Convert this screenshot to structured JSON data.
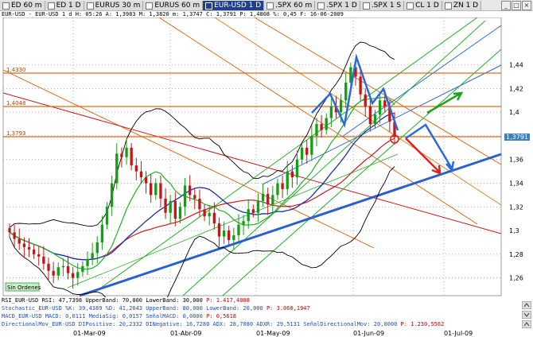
{
  "tabs": [
    {
      "label": "ED 60 m",
      "active": false
    },
    {
      "label": "ED 1 D",
      "active": false
    },
    {
      "label": "EURUS 30 m",
      "active": false
    },
    {
      "label": "EURUS 60 m",
      "active": false
    },
    {
      "label": "EUR-USD 1 D",
      "active": true
    },
    {
      "label": ".SPX 60 m",
      "active": false
    },
    {
      "label": ".SPX 1 D",
      "active": false
    },
    {
      "label": ".SPX 1 S",
      "active": false
    },
    {
      "label": "CL 1 D",
      "active": false
    },
    {
      "label": "ZN 1 D",
      "active": false
    }
  ],
  "window_buttons": [
    "_",
    "□",
    "×"
  ],
  "info_line": "EUR-USD - EUR-USD   1 d  H: 05:26  A: 1,3983  M: 1,3820  m: 1,3747  C: 1,3791  P: 1,4808  %: 0,45  F: 16-06-2009",
  "current_price_tag": "1,3791",
  "annotation": "Sin Ordenes",
  "chart_data": {
    "type": "candlestick",
    "symbol": "EUR-USD",
    "timeframe": "1 D",
    "ylim": [
      1.245,
      1.48
    ],
    "y_ticks": [
      1.26,
      1.28,
      1.3,
      1.32,
      1.34,
      1.36,
      1.38,
      1.4,
      1.42,
      1.44
    ],
    "y_tick_labels": [
      "1,26",
      "1,28",
      "1,3",
      "1,32",
      "1,34",
      "1,36",
      "1,38",
      "1,4",
      "1,42",
      "1,44"
    ],
    "x_labels": [
      "01-Mar-09",
      "01-Abr-09",
      "01-May-09",
      "01-Jun-09",
      "01-Jul-09"
    ],
    "hlines": [
      {
        "value": 1.433,
        "label": "1,4330"
      },
      {
        "value": 1.4048,
        "label": "1,4048"
      },
      {
        "value": 1.3793,
        "label": "1,3793"
      }
    ],
    "closes": [
      1.2985,
      1.293,
      1.289,
      1.286,
      1.284,
      1.28,
      1.278,
      1.272,
      1.266,
      1.262,
      1.269,
      1.27,
      1.264,
      1.26,
      1.265,
      1.27,
      1.276,
      1.281,
      1.29,
      1.305,
      1.32,
      1.34,
      1.365,
      1.362,
      1.37,
      1.355,
      1.35,
      1.345,
      1.34,
      1.33,
      1.34,
      1.327,
      1.315,
      1.325,
      1.31,
      1.32,
      1.338,
      1.33,
      1.327,
      1.318,
      1.312,
      1.315,
      1.306,
      1.295,
      1.3,
      1.292,
      1.296,
      1.305,
      1.308,
      1.318,
      1.315,
      1.325,
      1.331,
      1.322,
      1.33,
      1.34,
      1.335,
      1.35,
      1.345,
      1.36,
      1.37,
      1.364,
      1.38,
      1.39,
      1.385,
      1.395,
      1.405,
      1.4,
      1.41,
      1.425,
      1.438,
      1.43,
      1.415,
      1.405,
      1.39,
      1.398,
      1.41,
      1.405,
      1.392,
      1.3791
    ],
    "projection_arrows": [
      {
        "label": "bullish",
        "color": "#22a022"
      },
      {
        "label": "bearish",
        "color": "#e02020"
      },
      {
        "label": "path",
        "color": "#2a6ae0"
      }
    ]
  },
  "indicators": [
    {
      "text": "RSI_EUR-USD RSI: 47,7398  UpperBand: 70,000  LowerBand: 30,000 ",
      "value": "P: 1.417,4008",
      "color": "#000"
    },
    {
      "text": "Stochastic_EUR-USD %K: 39,4389  %D: 41,2643  UpperBand: 80,000  LowerBand: 20,000 ",
      "value": "P: 3.060,1947",
      "color": "#1f4fbf"
    },
    {
      "text": "MACD_EUR-USD MACD: 0,0111  MediaSig: 0,0157  SeñalMACD: 0,0000 ",
      "value": "P: 0,5618",
      "color": "#1f4fbf"
    },
    {
      "text": "DirectionalMov_EUR-USD DIPositive: 20,2332  DINegative: 16,7280  ADX: 28,7080  ADXR: 29,5131  SeñalDirectionalMov: 20,0000 ",
      "value": "P: 1.230,5562",
      "color": "#1f4fbf"
    }
  ]
}
